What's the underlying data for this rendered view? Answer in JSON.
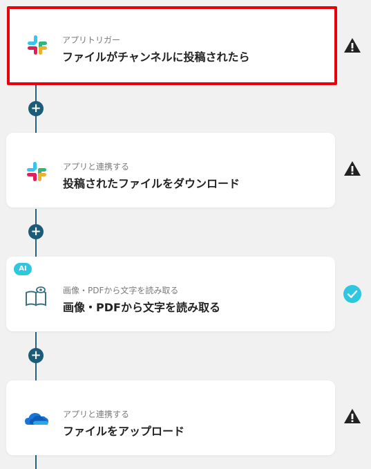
{
  "steps": [
    {
      "subtitle": "アプリトリガー",
      "title": "ファイルがチャンネルに投稿されたら",
      "icon": "slack-icon",
      "status": "warning"
    },
    {
      "subtitle": "アプリと連携する",
      "title": "投稿されたファイルをダウンロード",
      "icon": "slack-icon",
      "status": "warning"
    },
    {
      "subtitle": "画像・PDFから文字を読み取る",
      "title": "画像・PDFから文字を読み取る",
      "icon": "book-eye-icon",
      "badge": "AI",
      "status": "complete"
    },
    {
      "subtitle": "アプリと連携する",
      "title": "ファイルをアップロード",
      "icon": "onedrive-icon",
      "status": "warning"
    }
  ],
  "add_button": {
    "label": "+"
  },
  "colors": {
    "connector": "#26607a",
    "accent": "#2fc7e0",
    "selected_border": "#e8000b"
  }
}
